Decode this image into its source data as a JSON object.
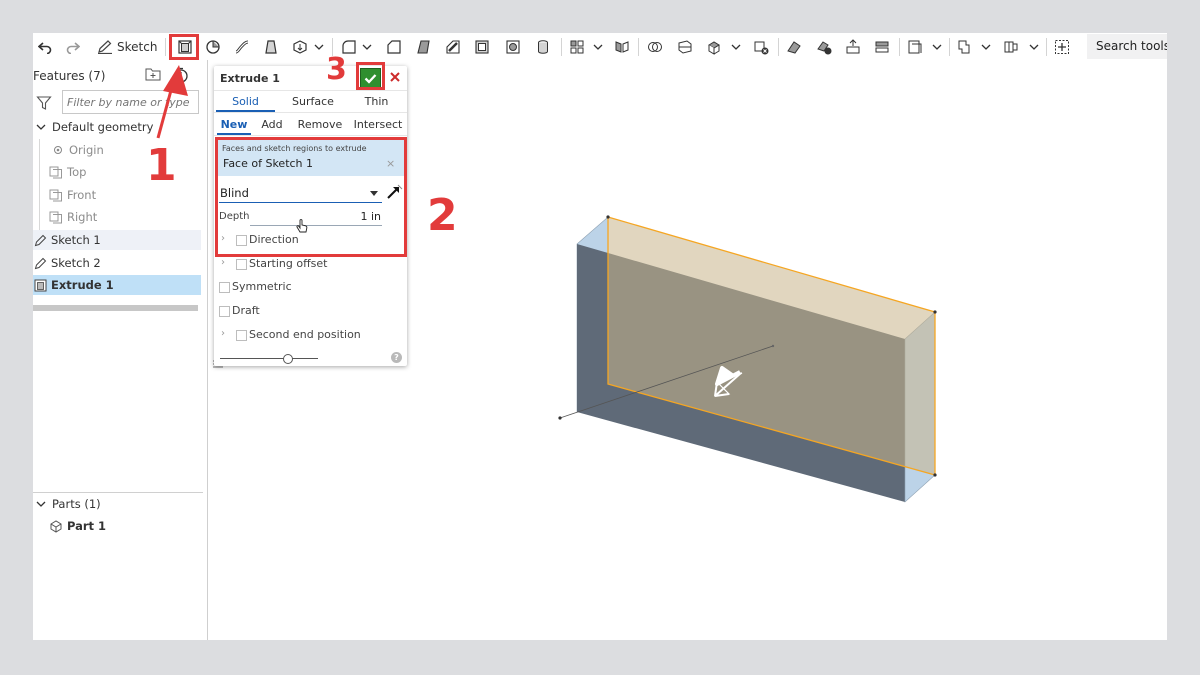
{
  "toolbar": {
    "sketch_label": "Sketch",
    "search_placeholder": "Search tools..."
  },
  "features": {
    "title": "Features (7)",
    "filter_placeholder": "Filter by name or type",
    "default_geometry": "Default geometry",
    "items": [
      "Origin",
      "Top",
      "Front",
      "Right"
    ],
    "sketch1": "Sketch 1",
    "sketch2": "Sketch 2",
    "extrude1": "Extrude 1",
    "parts_header": "Parts (1)",
    "part1": "Part 1"
  },
  "dialog": {
    "title": "Extrude 1",
    "tabs": [
      "Solid",
      "Surface",
      "Thin"
    ],
    "ops": [
      "New",
      "Add",
      "Remove",
      "Intersect"
    ],
    "faces_label": "Faces and sketch regions to extrude",
    "faces_value": "Face of Sketch 1",
    "end_type": "Blind",
    "depth_label": "Depth",
    "depth_value": "1 in",
    "direction": "Direction",
    "starting_offset": "Starting offset",
    "symmetric": "Symmetric",
    "draft": "Draft",
    "second_end": "Second end position"
  },
  "annotations": {
    "step1": "1",
    "step2": "2",
    "step3": "3"
  },
  "colors": {
    "accent": "#1a5fb4",
    "annotation": "#e23b3b",
    "confirm": "#2f8f2f",
    "selected_row": "#bfe0f7",
    "highlight_edge": "#f5a623"
  }
}
